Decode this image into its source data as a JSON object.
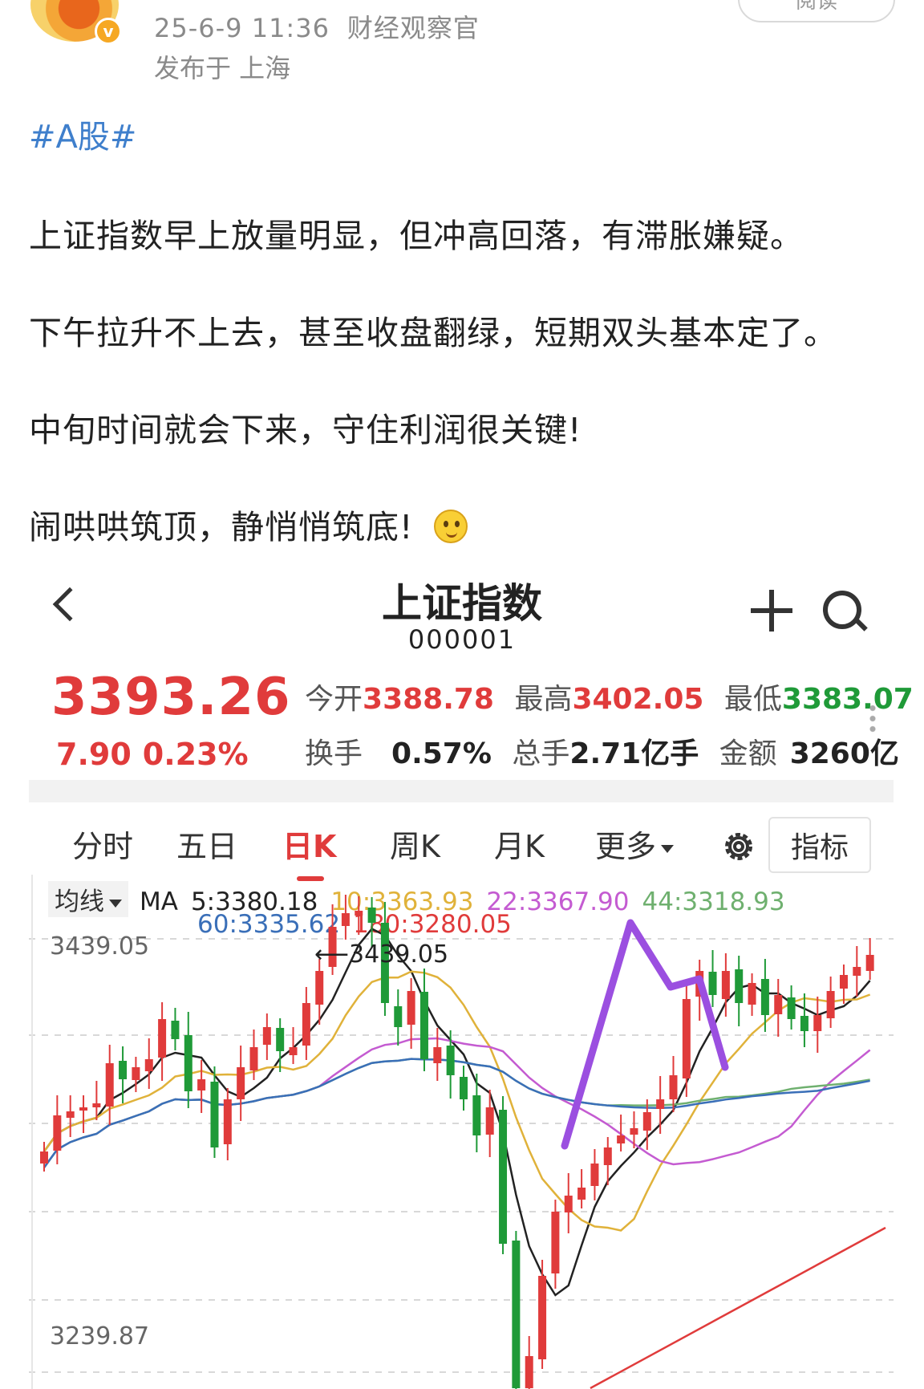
{
  "post": {
    "date_time": "25-6-9 11:36",
    "author": "财经观察官",
    "location": "发布于 上海",
    "read_button": "阅读",
    "verified_badge": "v",
    "hashtag": "#A股#",
    "paragraphs": [
      "上证指数早上放量明显，但冲高回落，有滞胀嫌疑。",
      "下午拉升不上去，甚至收盘翻绿，短期双头基本定了。",
      "中旬时间就会下来，守住利润很关键!",
      "闹哄哄筑顶，静悄悄筑底!"
    ],
    "emoji": "thinking-face-icon"
  },
  "stock": {
    "title": "上证指数",
    "code": "000001",
    "price": "3393.26",
    "change": "7.90",
    "change_pct": "0.23%",
    "quote": {
      "open_label": "今开",
      "open": "3388.78",
      "high_label": "最高",
      "high": "3402.05",
      "low_label": "最低",
      "low": "3383.07",
      "turnover_label": "换手",
      "turnover": "0.57%",
      "volume_label": "总手",
      "volume": "2.71亿手",
      "amount_label": "金额",
      "amount": "3260亿"
    },
    "tabs": [
      "分时",
      "五日",
      "日K",
      "周K",
      "月K",
      "更多"
    ],
    "active_tab": "日K",
    "indicator_button": "指标",
    "ma_toggle": "均线",
    "ma_prefix": "MA",
    "ma_values": [
      {
        "label": "5:3380.18",
        "color": "#222222"
      },
      {
        "label": "10:3363.93",
        "color": "#e0b23a"
      },
      {
        "label": "22:3367.90",
        "color": "#c45bd1"
      },
      {
        "label": "44:3318.93",
        "color": "#6fb06f"
      },
      {
        "label": "60:3335.62",
        "color": "#3a6fb8"
      },
      {
        "label": "180:3280.05",
        "color": "#e03b3b"
      }
    ],
    "colors": {
      "up": "#e03b3b",
      "down": "#1f9a38",
      "annotation": "#9b4fe0"
    }
  },
  "chart_data": {
    "type": "candlestick",
    "y_axis_labels": [
      "3439.05",
      "3239.87"
    ],
    "max_marker": "3439.05",
    "ylim": [
      3220,
      3460
    ],
    "annotation": "double-top shape drawn in purple (M pattern)"
  }
}
